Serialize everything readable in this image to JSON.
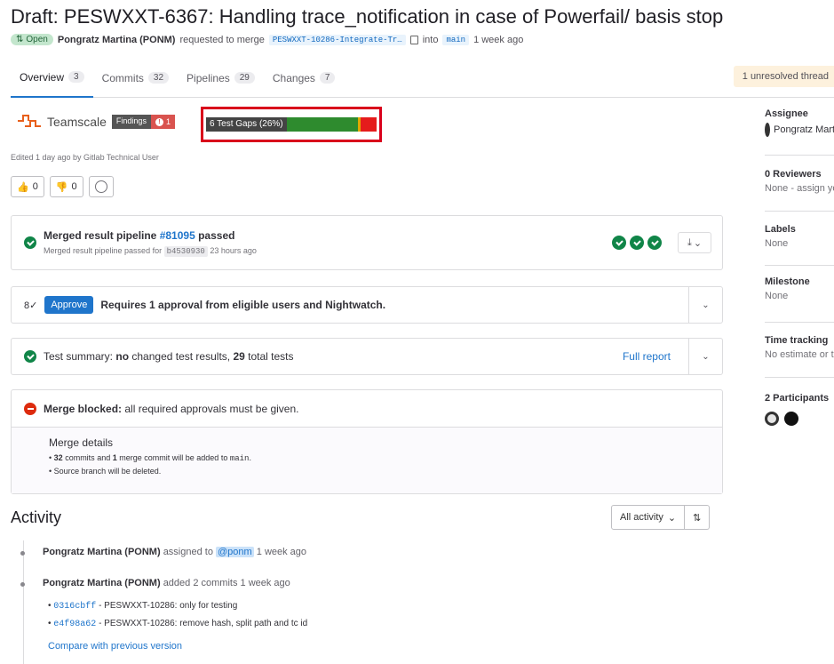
{
  "title": "Draft: PESWXXT-6367: Handling trace_notification in case of Powerfail/ basis stop",
  "meta": {
    "status": "Open",
    "author": "Pongratz Martina (PONM)",
    "requested_text": "requested to merge",
    "source_branch": "PESWXXT-10286-Integrate-Tr…",
    "into_text": "into",
    "target_branch": "main",
    "time": "1 week ago"
  },
  "tabs": [
    {
      "label": "Overview",
      "count": "3"
    },
    {
      "label": "Commits",
      "count": "32"
    },
    {
      "label": "Pipelines",
      "count": "29"
    },
    {
      "label": "Changes",
      "count": "7"
    }
  ],
  "unresolved": "1 unresolved thread",
  "teamscale": {
    "logo_text": "Teamscale",
    "findings_label": "Findings",
    "findings_count": "1",
    "test_gaps": "6 Test Gaps (26%)"
  },
  "edited": "Edited 1 day ago by Gitlab Technical User",
  "reactions": {
    "thumbs_up": "0",
    "thumbs_down": "0"
  },
  "pipeline": {
    "text_pre": "Merged result pipeline",
    "id": "#81095",
    "status": "passed",
    "sub_pre": "Merged result pipeline passed for",
    "sha": "b4530930",
    "sub_post": "23 hours ago"
  },
  "approval": {
    "button": "Approve",
    "text": "Requires 1 approval from eligible users and Nightwatch."
  },
  "test_summary": {
    "pre": "Test summary:",
    "bold1": "no",
    "mid": "changed test results,",
    "bold2": "29",
    "post": "total tests",
    "link": "Full report"
  },
  "merge": {
    "bold": "Merge blocked:",
    "text": "all required approvals must be given.",
    "details_title": "Merge details",
    "detail1_count": "32",
    "detail1_mid": "commits and",
    "detail1_count2": "1",
    "detail1_post": "merge commit will be added to",
    "detail1_branch": "main",
    "detail2": "Source branch will be deleted."
  },
  "activity": {
    "title": "Activity",
    "filter": "All activity",
    "entries": [
      {
        "author": "Pongratz Martina (PONM)",
        "action": "assigned to",
        "mention": "@ponm",
        "time": "1 week ago"
      },
      {
        "author": "Pongratz Martina (PONM)",
        "action": "added 2 commits",
        "time": "1 week ago"
      }
    ],
    "commits": [
      {
        "sha": "0316cbff",
        "msg": "- PESWXXT-10286: only for testing"
      },
      {
        "sha": "e4f98a62",
        "msg": "- PESWXXT-10286: remove hash, split path and tc id"
      }
    ],
    "compare": "Compare with previous version"
  },
  "sidebar": {
    "assignee_title": "Assignee",
    "assignee_name": "Pongratz Martina",
    "reviewers_title": "0 Reviewers",
    "reviewers_val": "None - assign yourself",
    "labels_title": "Labels",
    "labels_val": "None",
    "milestone_title": "Milestone",
    "milestone_val": "None",
    "time_title": "Time tracking",
    "time_val": "No estimate or time spent",
    "participants_title": "2 Participants"
  },
  "colors": {
    "accent": "#1f75cb",
    "success": "#108548",
    "danger": "#dd2b0e",
    "highlight_box": "#d9001b"
  }
}
